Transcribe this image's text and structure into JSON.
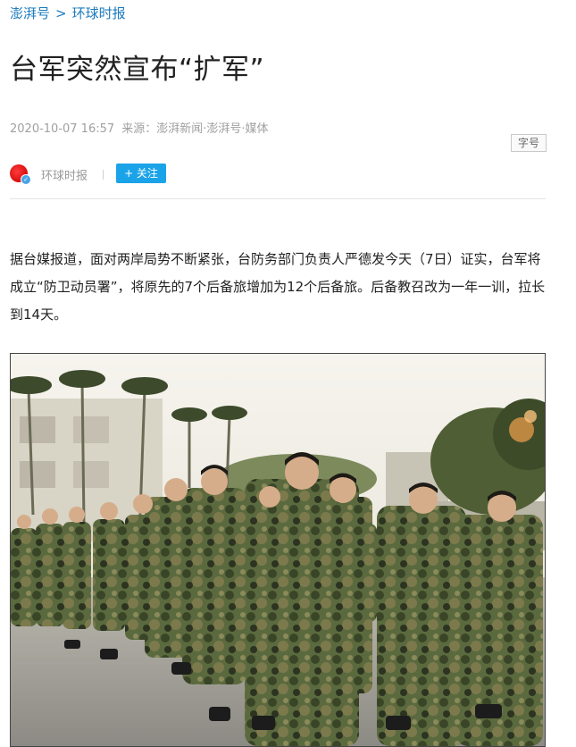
{
  "breadcrumb": {
    "root": "澎湃号",
    "separator": ">",
    "channel": "环球时报"
  },
  "article": {
    "title": "台军突然宣布“扩军”",
    "datetime": "2020-10-07 16:57",
    "source": "来源：澎湃新闻·澎湃号·媒体",
    "font_size_label": "字号",
    "body": "据台媒报道，面对两岸局势不断紧张，台防务部门负责人严德发今天（7日）证实，台军将成立“防卫动员署”，将原先的7个后备旅增加为12个后备旅。后备教召改为一年一训，拉长到14天。"
  },
  "author": {
    "name": "环球时报",
    "follow_label": "+ 关注"
  },
  "colors": {
    "link": "#1a7bbf",
    "follow_button": "#1aa3e8",
    "meta_text": "#a0a0a0"
  },
  "icons": {
    "avatar": "newspaper-avatar",
    "verified": "verified-badge-icon"
  }
}
